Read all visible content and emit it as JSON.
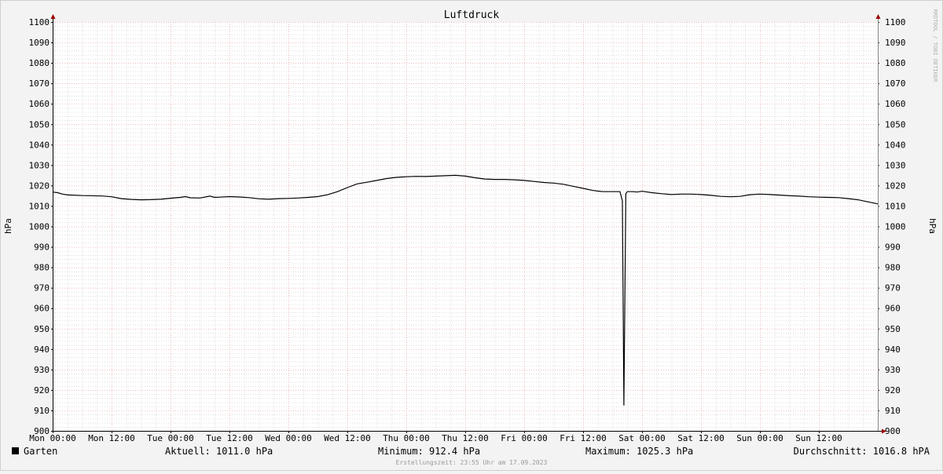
{
  "chart_data": {
    "type": "line",
    "title": "Luftdruck",
    "ylabel": "hPa",
    "ylabel_right": "hPa",
    "watermark": "RRDTOOL / TOBI OETIKER",
    "ylim": [
      900,
      1100
    ],
    "y_ticks": [
      900,
      910,
      920,
      930,
      940,
      950,
      960,
      970,
      980,
      990,
      1000,
      1010,
      1020,
      1030,
      1040,
      1050,
      1060,
      1070,
      1080,
      1090,
      1100
    ],
    "x_range_hours": [
      0,
      168
    ],
    "x_tick_labels": [
      "Mon 00:00",
      "Mon 12:00",
      "Tue 00:00",
      "Tue 12:00",
      "Wed 00:00",
      "Wed 12:00",
      "Thu 00:00",
      "Thu 12:00",
      "Fri 00:00",
      "Fri 12:00",
      "Sat 00:00",
      "Sat 12:00",
      "Sun 00:00",
      "Sun 12:00"
    ],
    "series": [
      {
        "name": "Garten",
        "color": "#000000",
        "x": [
          0,
          1,
          2,
          3,
          6,
          10,
          12,
          14,
          16,
          18,
          20,
          22,
          24,
          26,
          27,
          28,
          30,
          32,
          33,
          34,
          36,
          38,
          40,
          42,
          44,
          46,
          48,
          50,
          52,
          54,
          56,
          58,
          60,
          62,
          64,
          66,
          68,
          70,
          72,
          74,
          76,
          78,
          80,
          82,
          84,
          86,
          88,
          90,
          92,
          94,
          96,
          98,
          100,
          102,
          104,
          106,
          108,
          110,
          112,
          114,
          115.5,
          116.0,
          116.3,
          116.7,
          117,
          118,
          119,
          120,
          122,
          124,
          126,
          128,
          130,
          132,
          134,
          136,
          138,
          140,
          142,
          144,
          146,
          148,
          150,
          152,
          154,
          156,
          158,
          160,
          162,
          164,
          166,
          168
        ],
        "y": [
          1016.8,
          1016.5,
          1015.8,
          1015.4,
          1015.1,
          1014.9,
          1014.5,
          1013.6,
          1013.2,
          1013.0,
          1013.1,
          1013.3,
          1013.8,
          1014.2,
          1014.6,
          1014.0,
          1013.9,
          1014.8,
          1014.2,
          1014.3,
          1014.6,
          1014.4,
          1014.1,
          1013.5,
          1013.3,
          1013.6,
          1013.7,
          1013.9,
          1014.2,
          1014.6,
          1015.5,
          1017.0,
          1019.0,
          1020.8,
          1021.6,
          1022.5,
          1023.4,
          1024.0,
          1024.3,
          1024.5,
          1024.4,
          1024.6,
          1024.8,
          1025.0,
          1024.6,
          1023.8,
          1023.2,
          1023.0,
          1023.0,
          1022.8,
          1022.5,
          1022.0,
          1021.5,
          1021.2,
          1020.6,
          1019.6,
          1018.6,
          1017.6,
          1017.0,
          1017.0,
          1017.0,
          1012.5,
          912.4,
          1016.0,
          1017.0,
          1017.0,
          1016.8,
          1017.2,
          1016.5,
          1016.0,
          1015.6,
          1015.8,
          1015.8,
          1015.6,
          1015.2,
          1014.7,
          1014.5,
          1014.7,
          1015.5,
          1015.8,
          1015.6,
          1015.3,
          1015.0,
          1014.8,
          1014.5,
          1014.3,
          1014.2,
          1014.1,
          1013.6,
          1013.0,
          1012.0,
          1011.0
        ]
      }
    ],
    "legend": {
      "name": "Garten",
      "aktuell": "Aktuell: 1011.0 hPa",
      "minimum": "Minimum: 912.4 hPa",
      "maximum": "Maximum: 1025.3 hPa",
      "durchschnitt": "Durchschnitt: 1016.8 hPA"
    },
    "footer": "Erstellungszeit: 23:55 Uhr am 17.09.2023",
    "colors": {
      "background": "#f3f3f3",
      "plot_bg": "#ffffff",
      "major_grid": "#e8a0a0",
      "minor_grid": "#c8c8c8",
      "axis": "#000000",
      "arrow": "#a00000",
      "line": "#000000"
    }
  }
}
